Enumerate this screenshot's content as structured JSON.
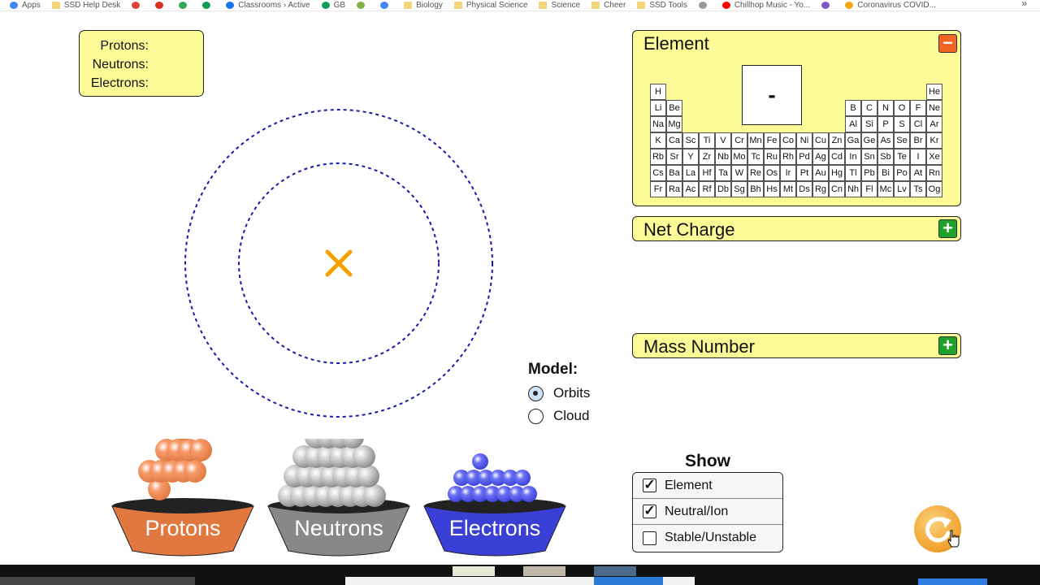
{
  "bookmarks": [
    {
      "label": "Apps",
      "icon": "apps-grid-icon",
      "color": "#4285f4"
    },
    {
      "label": "SSD Help Desk",
      "icon": "folder-icon",
      "color": "#f3d67a"
    },
    {
      "label": "",
      "icon": "chrome-icon",
      "color": "#db4437"
    },
    {
      "label": "",
      "icon": "gmail-icon",
      "color": "#d93025"
    },
    {
      "label": "",
      "icon": "drive-icon",
      "color": "#34a853"
    },
    {
      "label": "",
      "icon": "classroom-icon",
      "color": "#0f9d58"
    },
    {
      "label": "Classrooms › Active",
      "icon": "checkmark-icon",
      "color": "#1a73e8"
    },
    {
      "label": "GB",
      "icon": "gradebook-icon",
      "color": "#0f9d58"
    },
    {
      "label": "",
      "icon": "leaf-icon",
      "color": "#7cb342"
    },
    {
      "label": "",
      "icon": "google-icon",
      "color": "#4285f4"
    },
    {
      "label": "Biology",
      "icon": "folder-icon",
      "color": "#f3d67a"
    },
    {
      "label": "Physical Science",
      "icon": "folder-icon",
      "color": "#f3d67a"
    },
    {
      "label": "Science",
      "icon": "folder-icon",
      "color": "#f3d67a"
    },
    {
      "label": "Cheer",
      "icon": "folder-icon",
      "color": "#f3d67a"
    },
    {
      "label": "SSD Tools",
      "icon": "folder-icon",
      "color": "#f3d67a"
    },
    {
      "label": "",
      "icon": "lightbulb-icon",
      "color": "#999999"
    },
    {
      "label": "Chillhop Music - Yo...",
      "icon": "youtube-icon",
      "color": "#ff0000"
    },
    {
      "label": "",
      "icon": "profile-icon",
      "color": "#7e57c2"
    },
    {
      "label": "Coronavirus COVID...",
      "icon": "news-icon",
      "color": "#f3a712"
    }
  ],
  "bookmarks_more": "»",
  "counts": {
    "protons_label": "Protons:",
    "neutrons_label": "Neutrons:",
    "electrons_label": "Electrons:"
  },
  "atom": {
    "nucleus_marker": "×",
    "nucleus_color": "#f5a000",
    "orbit_color": "#1a1aa6"
  },
  "buckets": [
    {
      "label": "Protons",
      "color": "#e07840",
      "ball_color": "#f79a6a"
    },
    {
      "label": "Neutrons",
      "color": "#888888",
      "ball_color": "#d6d6d6"
    },
    {
      "label": "Electrons",
      "color": "#3a3fd6",
      "ball_color": "#6b72f5"
    }
  ],
  "model": {
    "title": "Model:",
    "options": [
      {
        "label": "Orbits",
        "selected": true
      },
      {
        "label": "Cloud",
        "selected": false
      }
    ]
  },
  "element_panel": {
    "title": "Element",
    "toggle": "−",
    "symbol": "-",
    "rows": [
      [
        "H",
        "",
        "",
        "",
        "",
        "",
        "",
        "",
        "",
        "",
        "",
        "",
        "",
        "",
        "",
        "",
        "",
        "He"
      ],
      [
        "Li",
        "Be",
        "",
        "",
        "",
        "",
        "",
        "",
        "",
        "",
        "",
        "",
        "B",
        "C",
        "N",
        "O",
        "F",
        "Ne"
      ],
      [
        "Na",
        "Mg",
        "",
        "",
        "",
        "",
        "",
        "",
        "",
        "",
        "",
        "",
        "Al",
        "Si",
        "P",
        "S",
        "Cl",
        "Ar"
      ],
      [
        "K",
        "Ca",
        "Sc",
        "Ti",
        "V",
        "Cr",
        "Mn",
        "Fe",
        "Co",
        "Ni",
        "Cu",
        "Zn",
        "Ga",
        "Ge",
        "As",
        "Se",
        "Br",
        "Kr"
      ],
      [
        "Rb",
        "Sr",
        "Y",
        "Zr",
        "Nb",
        "Mo",
        "Tc",
        "Ru",
        "Rh",
        "Pd",
        "Ag",
        "Cd",
        "In",
        "Sn",
        "Sb",
        "Te",
        "I",
        "Xe"
      ],
      [
        "Cs",
        "Ba",
        "La",
        "Hf",
        "Ta",
        "W",
        "Re",
        "Os",
        "Ir",
        "Pt",
        "Au",
        "Hg",
        "Tl",
        "Pb",
        "Bi",
        "Po",
        "At",
        "Rn"
      ],
      [
        "Fr",
        "Ra",
        "Ac",
        "Rf",
        "Db",
        "Sg",
        "Bh",
        "Hs",
        "Mt",
        "Ds",
        "Rg",
        "Cn",
        "Nh",
        "Fl",
        "Mc",
        "Lv",
        "Ts",
        "Og"
      ]
    ]
  },
  "net_charge_panel": {
    "title": "Net Charge",
    "toggle": "+"
  },
  "mass_number_panel": {
    "title": "Mass Number",
    "toggle": "+"
  },
  "show": {
    "title": "Show",
    "options": [
      {
        "label": "Element",
        "checked": true
      },
      {
        "label": "Neutral/Ion",
        "checked": true
      },
      {
        "label": "Stable/Unstable",
        "checked": false
      }
    ]
  },
  "reset_button": {
    "icon": "reset-arrow-icon",
    "color": "#f0a12c"
  }
}
